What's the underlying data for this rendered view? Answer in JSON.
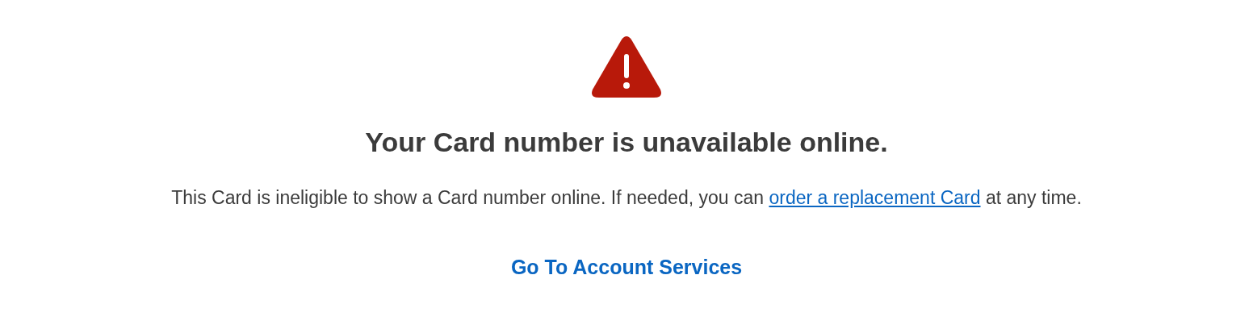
{
  "title": "Your Card number is unavailable online.",
  "message": {
    "before": "This Card is ineligible to show a Card number online. If needed, you can ",
    "link": "order a replacement Card",
    "after": " at any time."
  },
  "action": {
    "label": "Go To Account Services"
  }
}
